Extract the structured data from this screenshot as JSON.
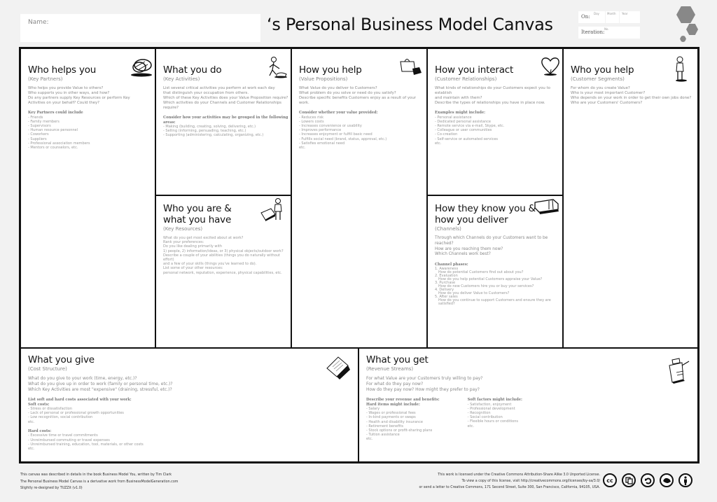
{
  "header": {
    "name_label": "Name:",
    "title": "‘s Personal Business Model Canvas",
    "on_label": "On:",
    "day_label": "Day",
    "month_label": "Month",
    "year_label": "Year",
    "iteration_label": "Iteration:",
    "no_label": "No."
  },
  "blocks": {
    "key_partners": {
      "title": "Who helps you",
      "subtitle": "(Key Partners)",
      "questions": "Who helps you provide Value to others?\nWho supports you in other ways, and how?\nDo any partners supply Key Resources or perform Key\nActivities on your behalf? Could they?",
      "list_heading": "Key Partners could include",
      "list": "- Friends\n- Family members\n- Supervisors\n- Human resource personnel\n- Coworkers\n- Suppliers\n- Professional association members\n- Mentors or counselors, etc.",
      "icon": "chain-links-icon"
    },
    "key_activities": {
      "title": "What you do",
      "subtitle": "(Key Activities)",
      "questions": "List several critical activities you perform at work each day\nthat distinguish your occupation from others.\nWhich of these Key Activities does your Value Proposition require?\nWhich activities do your Channels and Customer Relationships require?",
      "list_heading": "Consider how your activities may be grouped in the following areas:",
      "list": "- Making (building, creating, solving, delivering, etc.)\n- Selling (informing, persuading, teaching, etc.)\n- Supporting (administering, calculating, organizing, etc.)",
      "icon": "person-working-icon"
    },
    "key_resources": {
      "title_line1": "Who you are &",
      "title_line2": "what you have",
      "subtitle": "(Key Resources)",
      "questions": "What do you get most excited about at work?\nRank your preferences:\nDo you like dealing primarily with\n1) people, 2) information/ideas, or 3) physical objects/outdoor work?\nDescribe a couple of your abilities (things you do naturally without effort)\nand a few of your skills (things you've learned to do).\nList some of your other resources:\npersonal network, reputation, experience, physical capabilities, etc.",
      "icon": "person-with-cart-icon"
    },
    "value_propositions": {
      "title": "How you help",
      "subtitle": "(Value Propositions)",
      "questions": "What Value do you deliver to Customers?\nWhat problem do you solve or need do you satisfy?\nDescribe specific benefits Customers enjoy as a result of your work.",
      "list_heading": "Consider whether your value provided:",
      "list": "- Reduces risk\n- Lowers costs\n- Increases convenience or usability\n- Improves performance\n- Increases enjoyment or fulfill basic need\n- Fulfills social need (brand, status, approval, etc.)\n- Satisfies emotional need\n  etc.",
      "icon": "gift-bag-icon"
    },
    "customer_relationships": {
      "title": "How you interact",
      "subtitle": "(Customer Relationships)",
      "questions": "What kinds of relationships do your Customers expect you to establish\nand maintain with them?\nDescribe the types of relationships you have in place now.",
      "list_heading": "Examples might include:",
      "list": "- Personal assistance\n- Dedicated personal assistance\n- Remote service via e-mail, Skype, etc.\n- Colleague or user communities\n- Co-creation\n- Self-service or automated services\n  etc.",
      "icon": "heart-icon"
    },
    "channels": {
      "title_line1": "How they know you &",
      "title_line2": "how you deliver",
      "subtitle": "(Channels)",
      "questions": "Through which Channels do your Customers want to be reached?\nHow are you reaching them now?\nWhich Channels work best?",
      "list_heading": "Channel phases:",
      "phases": [
        {
          "label": "1. Awareness",
          "question": "How do potential Customers find out about you?"
        },
        {
          "label": "2. Evaluation",
          "question": "How do you help potential Customers appraise your Value?"
        },
        {
          "label": "3. Purchase",
          "question": "How do new Customers hire you or buy your services?"
        },
        {
          "label": "4. Delivery",
          "question": "How do you deliver Value to Customers?"
        },
        {
          "label": "5. After sales",
          "question": "How do you continue to support Customers and ensure they are satisfied?"
        }
      ],
      "icon": "delivery-truck-icon"
    },
    "customer_segments": {
      "title": "Who you help",
      "subtitle": "(Customer Segments)",
      "questions": "For whom do you create Value?\nWho is your most important Customer?\nWho depends on your work in order to get their own jobs done?\nWho are your Customers' Customers?",
      "icon": "standing-person-icon"
    },
    "cost_structure": {
      "title": "What you give",
      "subtitle": "(Cost Structure)",
      "questions": "What do you give to your work (time, energy, etc.)?\nWhat do you give up in order to work (family or personal time, etc.)?\nWhich Key Activities are most \"expensive\" (draining, stressful, etc.)?",
      "list_heading": "List soft and hard costs associated with your work:",
      "soft_heading": "Soft costs:",
      "soft_list": "- Stress or dissatisfaction\n- Lack of personal or professional growth opportunities\n- Low recognition, social contribution\n  etc.",
      "hard_heading": "Hard costs:",
      "hard_list": "- Excessive time or travel commitments\n- Unreimbursed commuting or travel expenses\n- Unreimbursed training, education, tool, materials, or other costs\n  etc.",
      "icon": "invoice-paper-icon"
    },
    "revenue_streams": {
      "title": "What you get",
      "subtitle": "(Revenue Streams)",
      "questions": "For what Value are your Customers truly willing to pay?\nFor what do they pay now?\nHow do they pay now? How might they prefer to pay?",
      "list_heading": "Describe your revenue and benefits:",
      "hard_heading": "Hard items might include:",
      "hard_list": "- Salary\n- Wages or professional fees\n- In-kind payments or swaps\n- Health and disability insurance\n- Retirement benefits\n- Stock options or profit-sharing plans\n- Tuition assistance\n  etc.",
      "soft_heading": "Soft factors might include:",
      "soft_list": "- Satisfaction, enjoyment\n- Professional development\n- Recognition\n- Social contribution\n- Flexible hours or conditions\n  etc.",
      "icon": "cash-register-icon"
    }
  },
  "footer": {
    "left": [
      "This canvas was described in details in the book Business Model You, written by Tim Clark",
      "The Personal Business Model Canvas is a derivative work from BusinessModelGeneration.com",
      "Slightly re-designed by TUZZit (v1.0)"
    ],
    "right": [
      "This work is licensed under the Creative Commons Attribution-Share Alike 3.0 Unported License.",
      "To view a copy of this license, visit http://creativecommons.org/licenses/by-sa/3.0/",
      "or send a letter to Creative Commons, 171 Second Street, Suite 300, San Francisco, California, 94105, USA."
    ],
    "license_icons": [
      "cc-icon",
      "copy-icon",
      "remix-icon",
      "noncommercial-icon",
      "attribution-icon"
    ],
    "cc_text": "cc"
  }
}
